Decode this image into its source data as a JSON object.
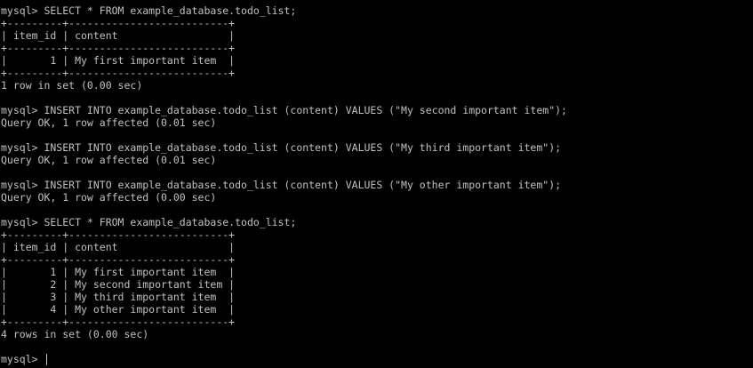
{
  "terminal": {
    "prompt": "mysql> ",
    "lines": [
      "mysql> SELECT * FROM example_database.todo_list;",
      "+---------+--------------------------+",
      "| item_id | content                  |",
      "+---------+--------------------------+",
      "|       1 | My first important item  |",
      "+---------+--------------------------+",
      "1 row in set (0.00 sec)",
      "",
      "mysql> INSERT INTO example_database.todo_list (content) VALUES (\"My second important item\");",
      "Query OK, 1 row affected (0.01 sec)",
      "",
      "mysql> INSERT INTO example_database.todo_list (content) VALUES (\"My third important item\");",
      "Query OK, 1 row affected (0.01 sec)",
      "",
      "mysql> INSERT INTO example_database.todo_list (content) VALUES (\"My other important item\");",
      "Query OK, 1 row affected (0.00 sec)",
      "",
      "mysql> SELECT * FROM example_database.todo_list;",
      "+---------+--------------------------+",
      "| item_id | content                  |",
      "+---------+--------------------------+",
      "|       1 | My first important item  |",
      "|       2 | My second important item |",
      "|       3 | My third important item  |",
      "|       4 | My other important item  |",
      "+---------+--------------------------+",
      "4 rows in set (0.00 sec)",
      ""
    ]
  },
  "colors": {
    "background": "#000000",
    "foreground": "#c0c0c0"
  }
}
